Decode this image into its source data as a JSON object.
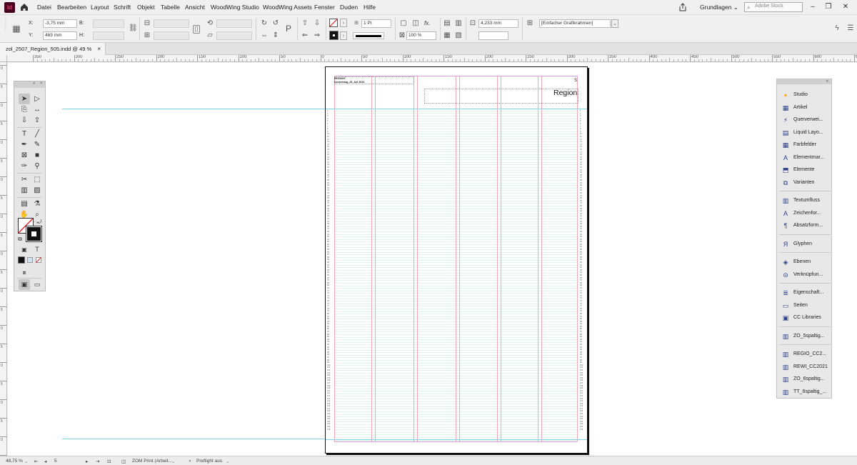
{
  "menubar": {
    "app_logo": "Id",
    "items": [
      "Datei",
      "Bearbeiten",
      "Layout",
      "Schrift",
      "Objekt",
      "Tabelle",
      "Ansicht",
      "WoodWing Studio",
      "WoodWing Assets",
      "Fenster",
      "Duden",
      "Hilfe"
    ],
    "workspace": "Grundlagen",
    "search_placeholder": "Adobe Stock",
    "window_buttons": [
      "–",
      "❐",
      "✕"
    ]
  },
  "controlbar": {
    "x_label": "X:",
    "x_value": "-3,75 mm",
    "y_label": "Y:",
    "y_value": "469 mm",
    "b_label": "B:",
    "h_label": "H:",
    "stroke_weight": "1 Pt",
    "opacity": "100 %",
    "fx_label": "fx.",
    "gap_value": "4,233 mm",
    "frame_style": "[Einfacher Grafikrahmen]"
  },
  "document": {
    "tab_title": "zol_2507_Region_505.indd @ 49 %",
    "close": "×",
    "page_header_name": "REGION7",
    "page_header_date": "Donnerstag, 25. Juli 2024",
    "region_title": "Region",
    "region_s": "S",
    "line_count": 125
  },
  "ruler": {
    "h_labels": [
      "350",
      "300",
      "250",
      "200",
      "150",
      "100",
      "50",
      "0",
      "50",
      "100",
      "150",
      "200",
      "250",
      "300",
      "350",
      "400",
      "450",
      "500",
      "550",
      "600",
      "650"
    ],
    "v_labels": [
      "0",
      "5",
      "0",
      "5",
      "0",
      "5",
      "0",
      "5",
      "0",
      "5",
      "0",
      "5",
      "0",
      "5",
      "0",
      "5",
      "0",
      "5",
      "0",
      "5",
      "0",
      "5"
    ]
  },
  "tools_panel": {
    "collapse": "«",
    "close": "×"
  },
  "right_panel": {
    "collapse": "»",
    "items": [
      {
        "label": "Studio",
        "icon": "studio-icon"
      },
      {
        "label": "Artikel",
        "icon": "article-icon"
      },
      {
        "label": "Querverwei...",
        "icon": "crossref-icon"
      },
      {
        "label": "Liquid Layo...",
        "icon": "liquid-layout-icon"
      },
      {
        "label": "Farbfelder",
        "icon": "swatches-icon"
      },
      {
        "label": "Elementmar...",
        "icon": "element-marker-icon"
      },
      {
        "label": "Elemente",
        "icon": "elements-icon"
      },
      {
        "label": "Varianten",
        "icon": "variants-icon"
      },
      {
        "label": "Textumfluss",
        "icon": "text-wrap-icon"
      },
      {
        "label": "Zeichenfor...",
        "icon": "character-styles-icon"
      },
      {
        "label": "Absatzform...",
        "icon": "paragraph-styles-icon"
      },
      {
        "label": "Glyphen",
        "icon": "glyphs-icon"
      },
      {
        "label": "Ebenen",
        "icon": "layers-icon"
      },
      {
        "label": "Verknüpfun...",
        "icon": "links-icon"
      },
      {
        "label": "Eigenschaft...",
        "icon": "properties-icon"
      },
      {
        "label": "Seiten",
        "icon": "pages-icon"
      },
      {
        "label": "CC Libraries",
        "icon": "cc-libraries-icon"
      },
      {
        "label": "ZO_5spaltig...",
        "icon": "library-icon"
      },
      {
        "label": "REGIO_CC2...",
        "icon": "library-icon"
      },
      {
        "label": "REWI_CC2021",
        "icon": "library-icon"
      },
      {
        "label": "ZO_6spaltig...",
        "icon": "library-icon"
      },
      {
        "label": "TT_6spaltig_...",
        "icon": "library-icon"
      }
    ]
  },
  "statusbar": {
    "zoom": "48,75 %",
    "page": "5",
    "profile": "ZOM Print (Arbeit...",
    "preflight": "Preflight aus"
  },
  "colors": {
    "guide": "#7fd6e8",
    "column_guide": "#f2a6b8",
    "baseline": "#bfe8d6",
    "panel_icon": "#2c3e8c"
  }
}
